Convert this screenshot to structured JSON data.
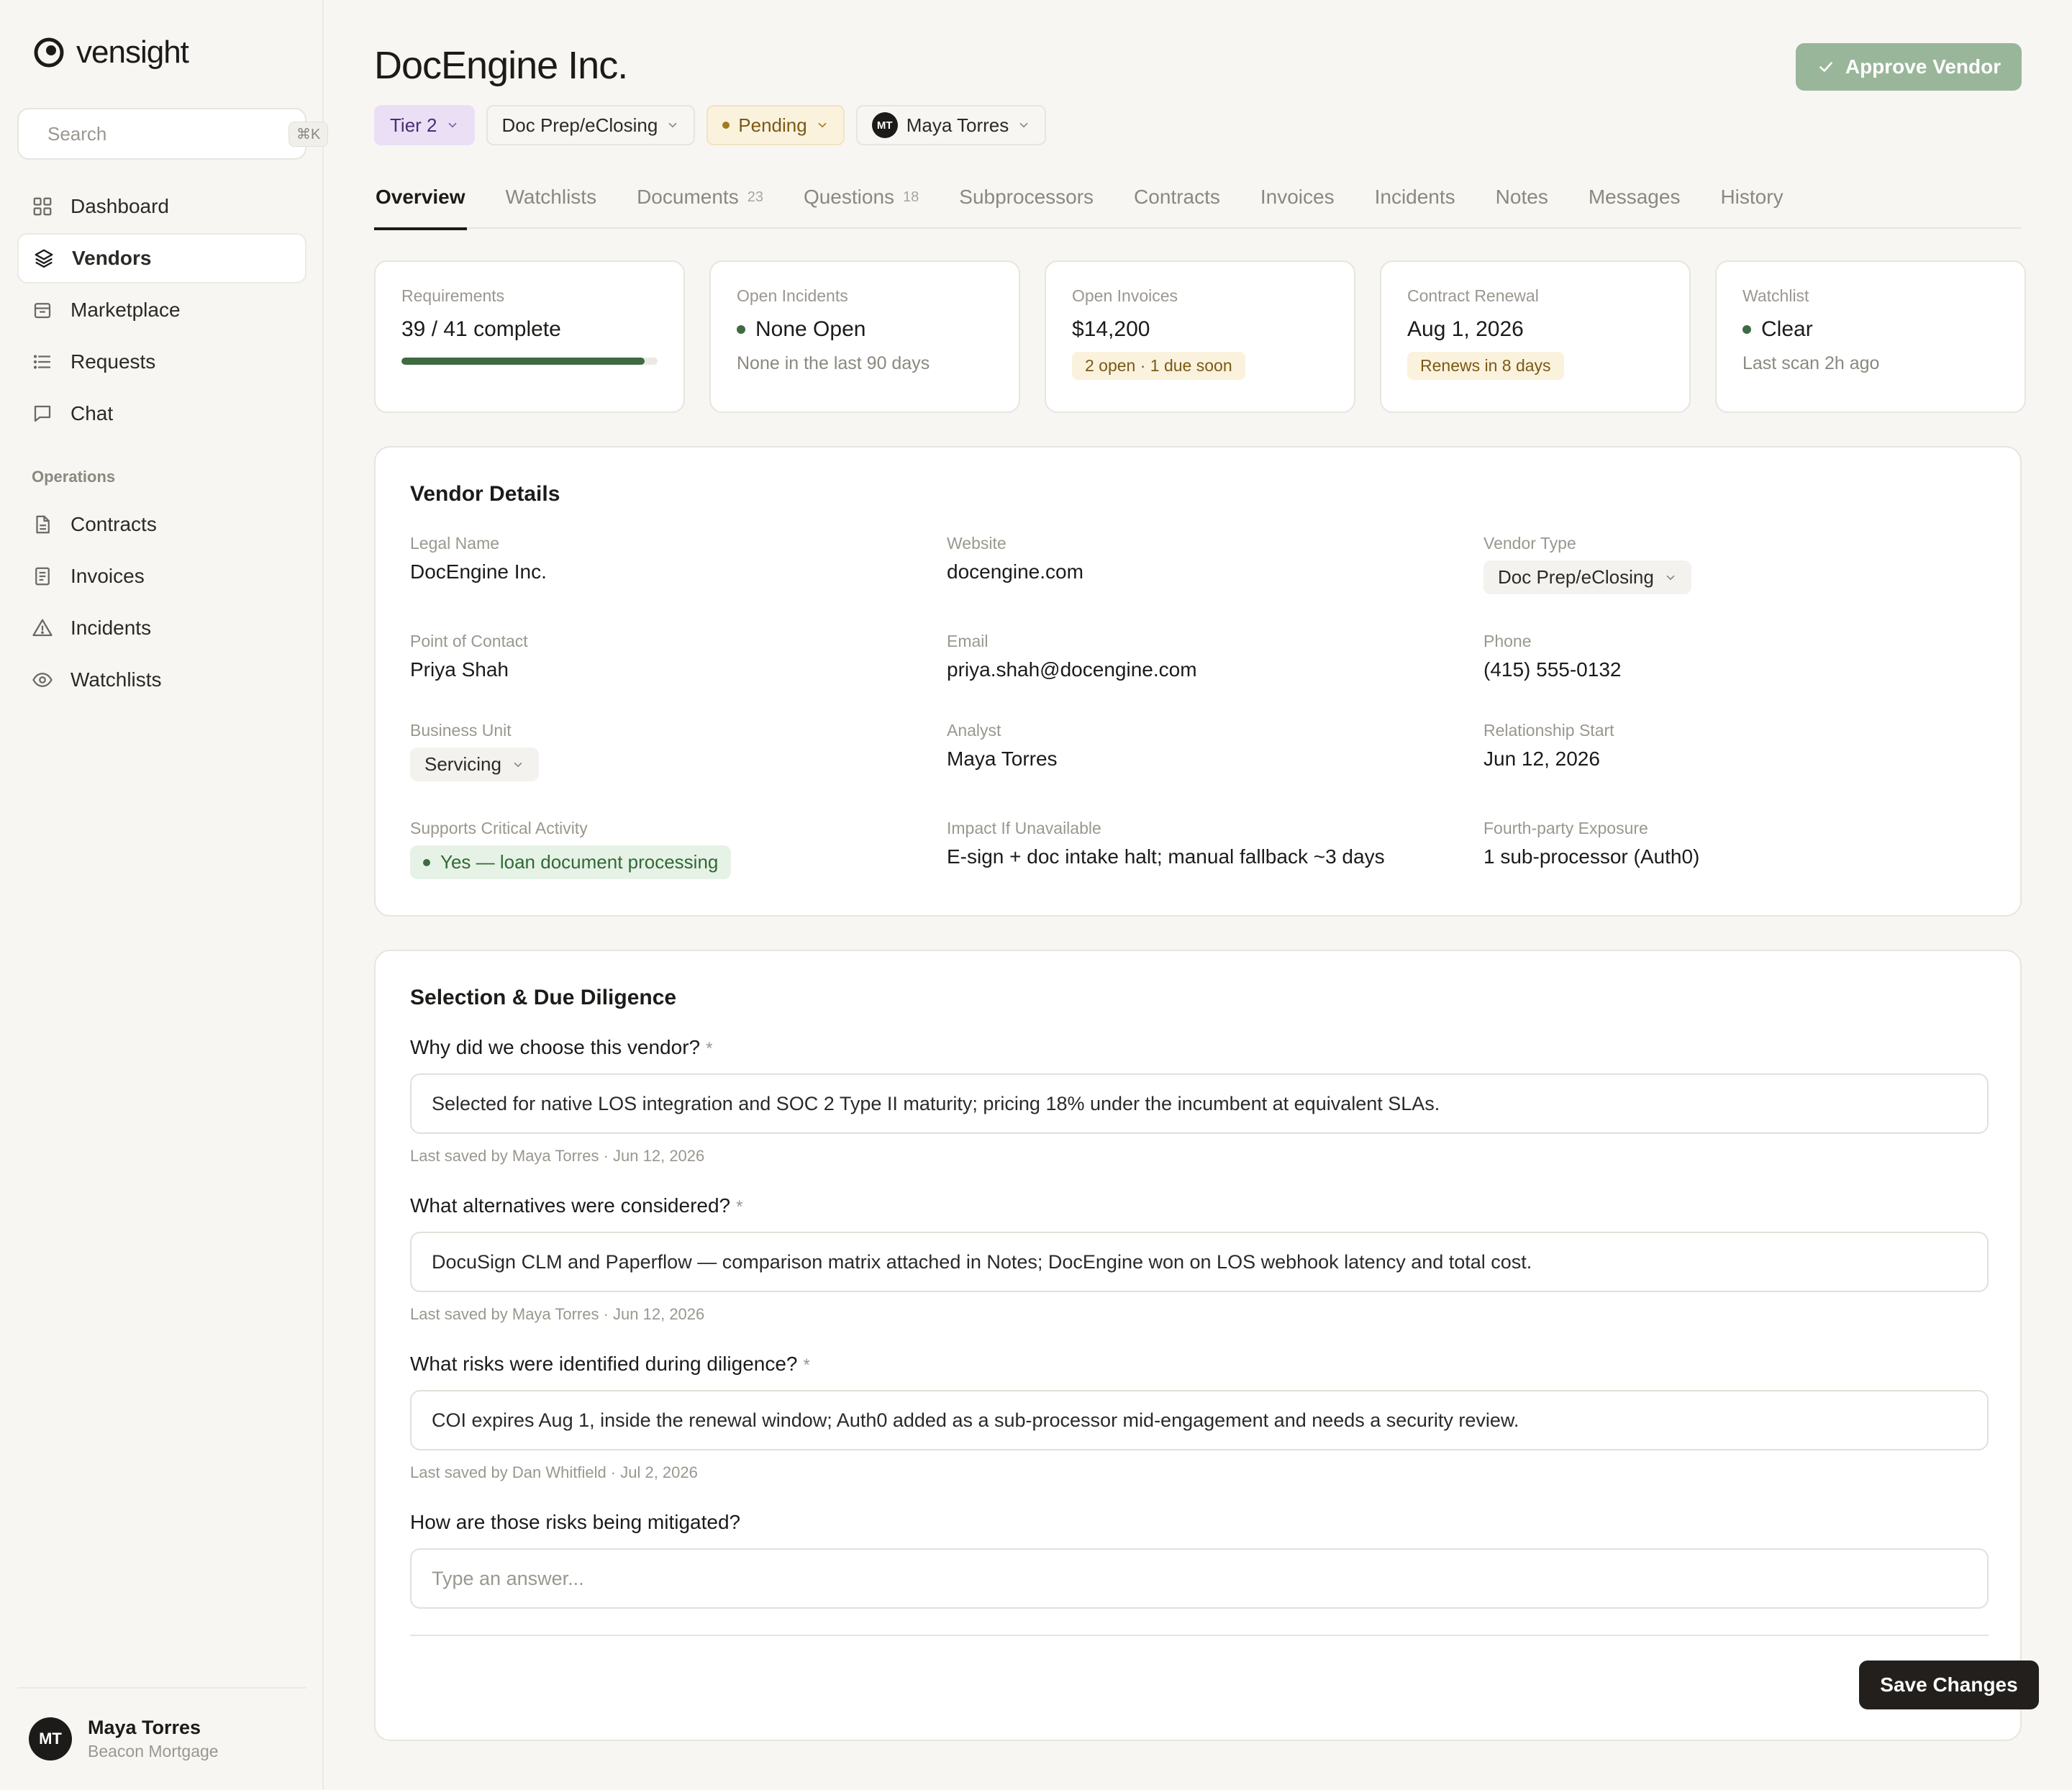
{
  "app": {
    "name": "vensight",
    "search_placeholder": "Search",
    "search_shortcut": "⌘K"
  },
  "sidebar": {
    "main_items": [
      {
        "label": "Dashboard",
        "icon": "grid-icon"
      },
      {
        "label": "Vendors",
        "icon": "layers-icon",
        "active": true
      },
      {
        "label": "Marketplace",
        "icon": "store-icon"
      },
      {
        "label": "Requests",
        "icon": "list-icon"
      },
      {
        "label": "Chat",
        "icon": "chat-icon"
      }
    ],
    "operations_title": "Operations",
    "operations_items": [
      {
        "label": "Contracts",
        "icon": "file-icon"
      },
      {
        "label": "Invoices",
        "icon": "receipt-icon"
      },
      {
        "label": "Incidents",
        "icon": "warning-icon"
      },
      {
        "label": "Watchlists",
        "icon": "eye-icon"
      }
    ],
    "user": {
      "initials": "MT",
      "name": "Maya Torres",
      "org": "Beacon Mortgage"
    }
  },
  "header": {
    "title": "DocEngine Inc.",
    "approve_label": "Approve Vendor",
    "chips": {
      "tier": "Tier 2",
      "type": "Doc Prep/eClosing",
      "status": "Pending",
      "owner_initials": "MT",
      "owner": "Maya Torres"
    }
  },
  "tabs": [
    {
      "label": "Overview",
      "count": "",
      "active": true
    },
    {
      "label": "Watchlists",
      "count": ""
    },
    {
      "label": "Documents",
      "count": "23"
    },
    {
      "label": "Questions",
      "count": "18"
    },
    {
      "label": "Subprocessors",
      "count": ""
    },
    {
      "label": "Contracts",
      "count": ""
    },
    {
      "label": "Invoices",
      "count": ""
    },
    {
      "label": "Incidents",
      "count": ""
    },
    {
      "label": "Notes",
      "count": ""
    },
    {
      "label": "Messages",
      "count": ""
    },
    {
      "label": "History",
      "count": ""
    }
  ],
  "stats": {
    "requirements": {
      "label": "Requirements",
      "value": "39 / 41 complete",
      "progress": 0.95
    },
    "incidents": {
      "label": "Open Incidents",
      "value": "None Open",
      "sub": "None in the last 90 days"
    },
    "invoices": {
      "label": "Open Invoices",
      "value": "$14,200",
      "badge": "2 open · 1 due soon"
    },
    "renewal": {
      "label": "Contract Renewal",
      "value": "Aug 1, 2026",
      "badge": "Renews in 8 days"
    },
    "watchlist": {
      "label": "Watchlist",
      "value": "Clear",
      "sub": "Last scan 2h ago"
    }
  },
  "colors": {
    "green": "#3f6b43",
    "amber": "#a37b1f",
    "approve": "#9ab69a"
  },
  "details": {
    "title": "Vendor Details",
    "legal_name": {
      "label": "Legal Name",
      "value": "DocEngine Inc."
    },
    "website": {
      "label": "Website",
      "value": "docengine.com"
    },
    "vendor_type": {
      "label": "Vendor Type",
      "value": "Doc Prep/eClosing"
    },
    "contact": {
      "label": "Point of Contact",
      "value": "Priya Shah"
    },
    "email": {
      "label": "Email",
      "value": "priya.shah@docengine.com"
    },
    "phone": {
      "label": "Phone",
      "value": "(415) 555-0132"
    },
    "business_unit": {
      "label": "Business Unit",
      "value": "Servicing"
    },
    "analyst": {
      "label": "Analyst",
      "value": "Maya Torres"
    },
    "relationship_start": {
      "label": "Relationship Start",
      "value": "Jun 12, 2026"
    },
    "critical": {
      "label": "Supports Critical Activity",
      "value": "Yes — loan document processing"
    },
    "impact": {
      "label": "Impact If Unavailable",
      "value": "E-sign + doc intake halt; manual fallback ~3 days"
    },
    "fourth_party": {
      "label": "Fourth-party Exposure",
      "value": "1 sub-processor (Auth0)"
    }
  },
  "diligence": {
    "title": "Selection & Due Diligence",
    "questions": [
      {
        "label": "Why did we choose this vendor?",
        "required": "*",
        "answer": "Selected for native LOS integration and SOC 2 Type II maturity; pricing 18% under the incumbent at equivalent SLAs.",
        "meta": "Last saved by Maya Torres · Jun 12, 2026"
      },
      {
        "label": "What alternatives were considered?",
        "required": "*",
        "answer": "DocuSign CLM and Paperflow — comparison matrix attached in Notes; DocEngine won on LOS webhook latency and total cost.",
        "meta": "Last saved by Maya Torres · Jun 12, 2026"
      },
      {
        "label": "What risks were identified during diligence?",
        "required": "*",
        "answer": "COI expires Aug 1, inside the renewal window; Auth0 added as a sub-processor mid-engagement and needs a security review.",
        "meta": "Last saved by Dan Whitfield · Jul 2, 2026"
      },
      {
        "label": "How are those risks being mitigated?",
        "required": "",
        "answer": "",
        "placeholder": "Type an answer..."
      }
    ],
    "save_label": "Save Changes"
  }
}
